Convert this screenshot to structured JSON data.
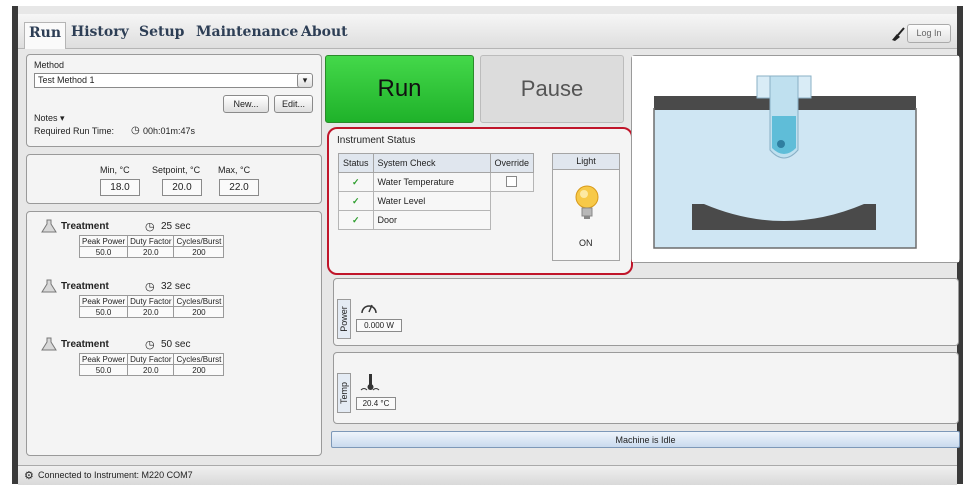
{
  "tabs": [
    "Run",
    "History",
    "Setup",
    "Maintenance",
    "About"
  ],
  "login_label": "Log In",
  "method": {
    "label": "Method",
    "value": "Test Method 1",
    "new_button": "New...",
    "edit_button": "Edit...",
    "notes_label": "Notes",
    "run_time_label": "Required Run Time:",
    "run_time_value": "00h:01m:47s"
  },
  "temperature": {
    "min_label": "Min, °C",
    "setpoint_label": "Setpoint, °C",
    "max_label": "Max, °C",
    "min": "18.0",
    "setpoint": "20.0",
    "max": "22.0"
  },
  "treatment_columns": [
    "Peak Power",
    "Duty Factor",
    "Cycles/Burst"
  ],
  "treatments": [
    {
      "name": "Treatment",
      "duration": "25 sec",
      "values": [
        "50.0",
        "20.0",
        "200"
      ]
    },
    {
      "name": "Treatment",
      "duration": "32 sec",
      "values": [
        "50.0",
        "20.0",
        "200"
      ]
    },
    {
      "name": "Treatment",
      "duration": "50 sec",
      "values": [
        "50.0",
        "20.0",
        "200"
      ]
    }
  ],
  "run_button": "Run",
  "pause_button": "Pause",
  "instrument_status": {
    "title": "Instrument Status",
    "headers": [
      "Status",
      "System Check",
      "Override"
    ],
    "rows": [
      {
        "status": "✓",
        "check": "Water Temperature"
      },
      {
        "status": "✓",
        "check": "Water Level"
      },
      {
        "status": "✓",
        "check": "Door"
      }
    ],
    "light_header": "Light",
    "light_state": "ON"
  },
  "power": {
    "label": "Power",
    "value": "0.000 W"
  },
  "temp": {
    "label": "Temp",
    "value": "20.4 °C"
  },
  "machine_status": "Machine is Idle",
  "connection_status": "Connected to Instrument: M220 COM7",
  "colors": {
    "run": "#22b52c",
    "highlight": "#c0152a",
    "water": "#cde6f3",
    "accent": "#2d3e55"
  }
}
